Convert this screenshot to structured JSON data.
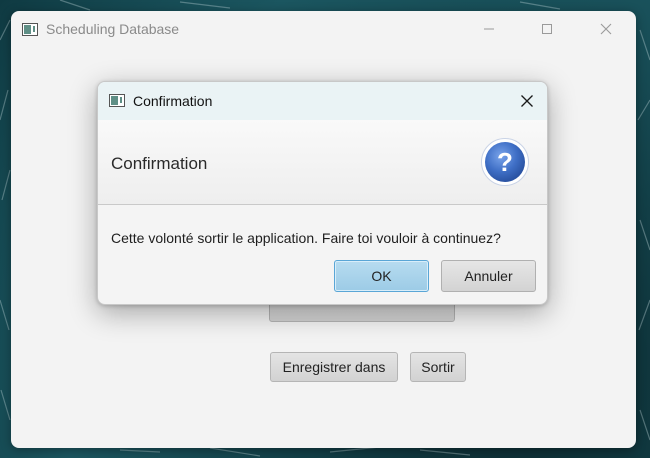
{
  "main_window": {
    "title": "Scheduling Database",
    "buttons": {
      "save_to": "Enregistrer dans",
      "exit": "Sortir"
    }
  },
  "dialog": {
    "title": "Confirmation",
    "header": "Confirmation",
    "message": "Cette volonté sortir le application. Faire toi vouloir à continuez?",
    "question_mark": "?",
    "buttons": {
      "ok": "OK",
      "cancel": "Annuler"
    }
  },
  "colors": {
    "desktop_background": "#164a52",
    "dialog_titlebar": "#eaf3f5",
    "default_button": "#9ccbe6",
    "question_icon": "#3f6fc6"
  },
  "icons": {
    "window_controls": [
      "minimize-icon",
      "maximize-icon",
      "close-icon"
    ],
    "dialog_icon": "question-icon"
  }
}
